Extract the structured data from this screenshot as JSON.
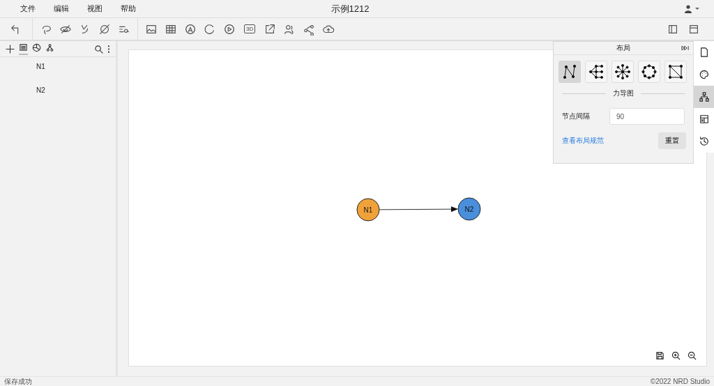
{
  "menu": [
    "文件",
    "编辑",
    "视图",
    "帮助"
  ],
  "title": "示例1212",
  "toolbar": {
    "three_d": "3D"
  },
  "left_panel": {
    "tabs": [
      {
        "kind": "list",
        "selected": true
      },
      {
        "kind": "chart",
        "selected": false
      },
      {
        "kind": "tree",
        "selected": false
      }
    ],
    "items": [
      "N1",
      "N2"
    ]
  },
  "graph": {
    "nodes": [
      {
        "label": "N1",
        "color": "#f0a23a"
      },
      {
        "label": "N2",
        "color": "#4a8fdc"
      }
    ]
  },
  "layout_panel": {
    "title": "布局",
    "options": [
      {
        "kind": "force",
        "selected": true
      },
      {
        "kind": "tree",
        "selected": false
      },
      {
        "kind": "radial",
        "selected": false
      },
      {
        "kind": "circle",
        "selected": false
      },
      {
        "kind": "grid",
        "selected": false
      }
    ],
    "section": "力导图",
    "field_label": "节点间隔",
    "field_value": "90",
    "link": "查看布局规范",
    "reset": "重置"
  },
  "right_rail": [
    {
      "kind": "page",
      "selected": false
    },
    {
      "kind": "palette",
      "selected": false
    },
    {
      "kind": "hierarchy",
      "selected": true
    },
    {
      "kind": "table",
      "selected": false
    },
    {
      "kind": "history",
      "selected": false
    }
  ],
  "status_bar": {
    "message": "保存成功",
    "copyright": "©2022 NRD Studio"
  }
}
